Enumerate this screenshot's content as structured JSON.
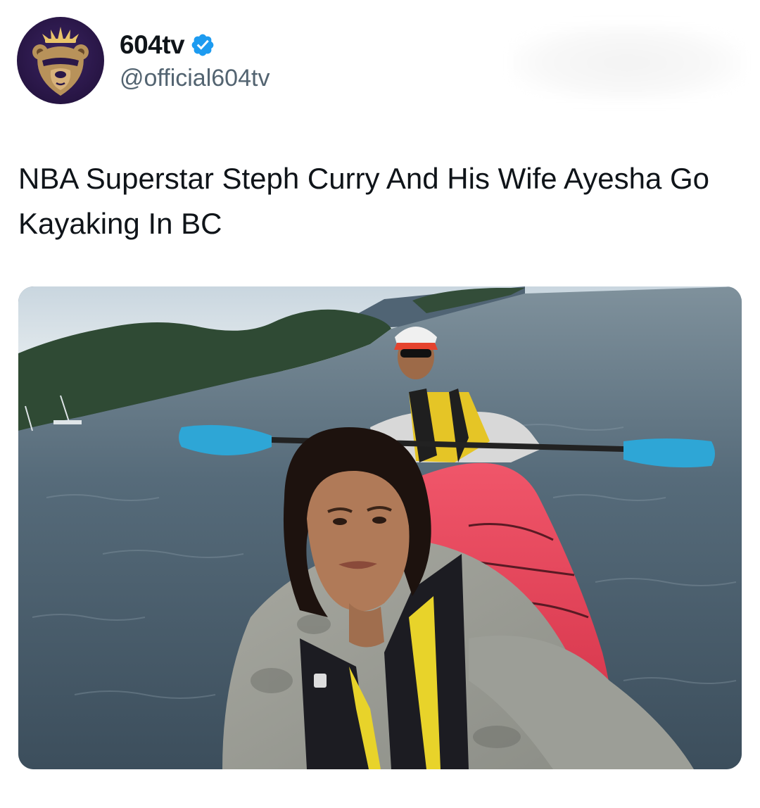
{
  "account": {
    "display_name": "604tv",
    "handle": "@official604tv",
    "verified": true,
    "verified_color": "#1d9bf0",
    "avatar_icon": "bear-with-crown-icon",
    "avatar_colors": {
      "background": "#2a1748",
      "bear": "#b8925a",
      "crown": "#e9c46a"
    }
  },
  "post": {
    "text": "NBA Superstar Steph Curry And His Wife Ayesha Go Kayaking In BC"
  },
  "media": {
    "type": "photo",
    "main_colors": {
      "water": "#4a5e6e",
      "kayak": "#e8404f",
      "paddle": "#2ea6d6",
      "trees": "#2f4a34"
    }
  }
}
